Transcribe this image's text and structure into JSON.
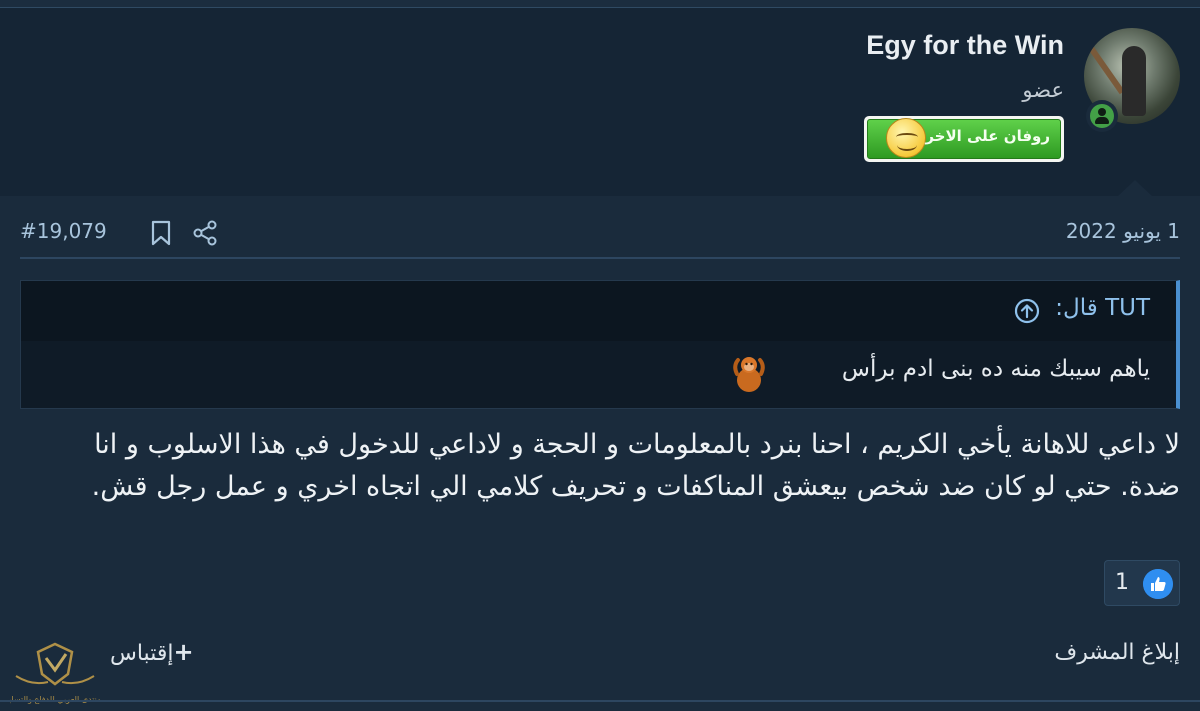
{
  "user": {
    "name": "Egy for the Win",
    "title": "عضو",
    "banner_text": "روفان على الاخر"
  },
  "post": {
    "date": "1 يونيو 2022",
    "number": "#19,079",
    "quote": {
      "author": "TUT قال:",
      "text": "ياهم سيبك منه ده بنى ادم برأس"
    },
    "message": "لا داعي للاهانة يأخي الكريم ، احنا بنرد بالمعلومات و الحجة و لاداعي للدخول في هذا الاسلوب و انا ضدة. حتي لو كان ضد شخص بيعشق المناكفات و تحريف كلامي الي اتجاه اخري و عمل رجل قش.",
    "reactions": {
      "like_count": "1"
    }
  },
  "actions": {
    "report_label": "إبلاغ المشرف",
    "quote_label": "إقتباس",
    "quote_plus": "+"
  },
  "watermark": {
    "text": "المنتدى العربي للدفاع والتسليح"
  },
  "colors": {
    "page_bg": "#1a2b3c",
    "header_bg": "#152535",
    "quote_bg": "#0f1b27",
    "accent": "#4a8fd0",
    "link": "#a8c4dc",
    "online": "#43a047",
    "like": "#2f8ef0"
  },
  "icons": [
    "bookmark-icon",
    "share-icon",
    "quote-arrow-icon",
    "orangutan-icon",
    "like-icon",
    "online-icon"
  ]
}
